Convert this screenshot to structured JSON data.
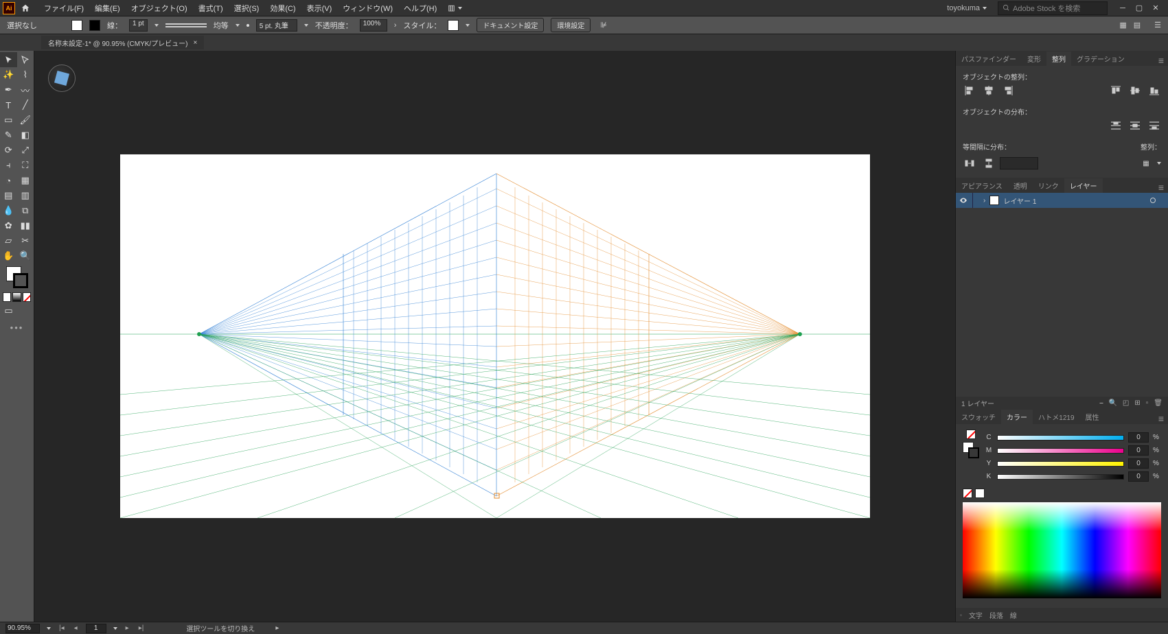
{
  "menubar": {
    "app_abbr": "Ai",
    "items": [
      "ファイル(F)",
      "編集(E)",
      "オブジェクト(O)",
      "書式(T)",
      "選択(S)",
      "効果(C)",
      "表示(V)",
      "ウィンドウ(W)",
      "ヘルプ(H)"
    ],
    "user": "toyokuma",
    "search_placeholder": "Adobe Stock を検索"
  },
  "control_bar": {
    "selection": "選択なし",
    "stroke_label": "線：",
    "stroke_weight": "1 pt",
    "stroke_style": "均等",
    "brush_size": "5 pt. 丸筆",
    "opacity_label": "不透明度：",
    "opacity_value": "100%",
    "style_label": "スタイル：",
    "doc_setup_btn": "ドキュメント設定",
    "prefs_btn": "環境設定"
  },
  "doc_tab": {
    "title": "名称未設定-1* @ 90.95% (CMYK/プレビュー)"
  },
  "align_panel": {
    "tabs": [
      "パスファインダー",
      "変形",
      "整列",
      "グラデーション"
    ],
    "active_tab": 2,
    "section1": "オブジェクトの整列：",
    "section2": "オブジェクトの分布：",
    "section3": "等間隔に分布：",
    "align_label": "整列："
  },
  "layers_panel": {
    "tabs": [
      "アピアランス",
      "透明",
      "リンク",
      "レイヤー"
    ],
    "active_tab": 3,
    "layer_name": "レイヤー 1",
    "status": "1 レイヤー"
  },
  "color_panel": {
    "tabs": [
      "スウォッチ",
      "カラー",
      "ハトメ1219",
      "属性"
    ],
    "active_tab": 1,
    "channels": [
      {
        "label": "C",
        "value": "0"
      },
      {
        "label": "M",
        "value": "0"
      },
      {
        "label": "Y",
        "value": "0"
      },
      {
        "label": "K",
        "value": "0"
      }
    ],
    "pct": "%"
  },
  "bottom_tabs": [
    "文字",
    "段落",
    "線"
  ],
  "status_bar": {
    "zoom": "90.95%",
    "page": "1",
    "hint": "選択ツールを切り換え"
  }
}
